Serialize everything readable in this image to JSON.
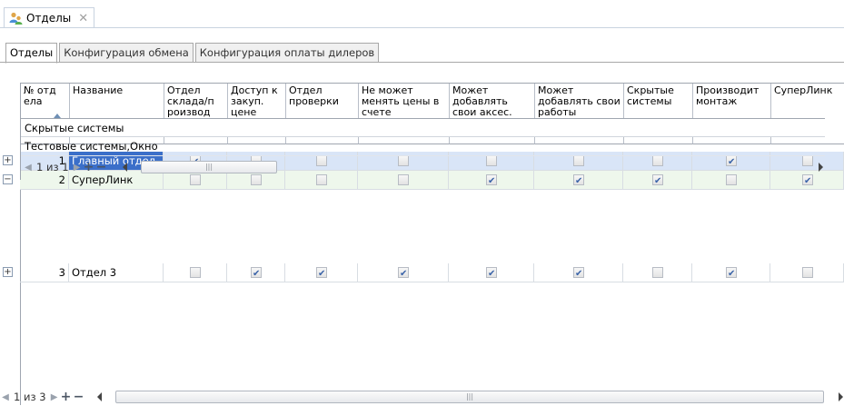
{
  "doc_tab": {
    "label": "Отделы",
    "icon": "users-group-icon",
    "close_icon": "close-icon"
  },
  "sub_tabs": [
    {
      "label": "Отделы",
      "active": true
    },
    {
      "label": "Конфигурация обмена",
      "active": false
    },
    {
      "label": "Конфигурация оплаты дилеров",
      "active": false
    }
  ],
  "grid": {
    "columns": [
      "№ отд ела",
      "Название",
      "Отдел склада/п роизвод ства",
      "Доступ к закуп. цене",
      "Отдел проверки",
      "Не может менять цены в счете",
      "Может добавлять свои аксес.",
      "Может добавлять свои работы",
      "Скрытые системы",
      "Производит монтаж",
      "СуперЛинк"
    ],
    "rows": [
      {
        "num": "1",
        "name": "Главный отдел",
        "expander": "+",
        "flags": [
          true,
          false,
          false,
          false,
          false,
          false,
          false,
          true,
          false
        ]
      },
      {
        "num": "2",
        "name": "СуперЛинк",
        "expander": "−",
        "flags": [
          false,
          false,
          false,
          false,
          true,
          true,
          true,
          false,
          true
        ]
      },
      {
        "num": "3",
        "name": "Отдел 3",
        "expander": "+",
        "flags": [
          false,
          true,
          true,
          true,
          true,
          true,
          false,
          true,
          false
        ]
      }
    ],
    "detail": {
      "header": "Скрытые системы",
      "row": "Тестовые системы,Окно",
      "pager": "1 из 1"
    },
    "pager": "1 из 3"
  },
  "colors": {
    "selection": "#3b6fc9",
    "alt_row": "#eef7ec"
  }
}
